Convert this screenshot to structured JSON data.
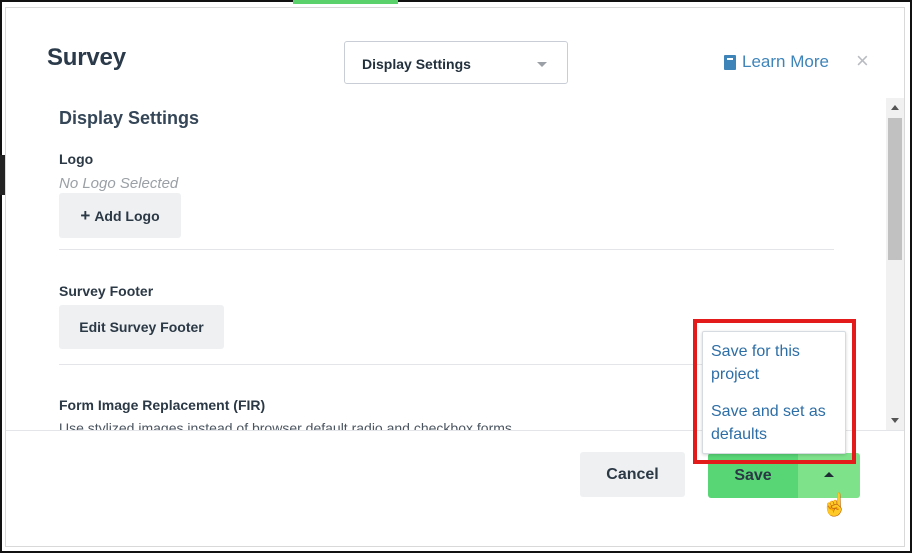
{
  "modal": {
    "title": "Survey",
    "close_icon": "close-icon"
  },
  "header": {
    "select_value": "Display Settings",
    "learn_more_label": "Learn More",
    "learn_more_icon": "book-icon"
  },
  "content": {
    "section_title": "Display Settings",
    "logo": {
      "label": "Logo",
      "status": "No Logo Selected",
      "add_button": "Add Logo",
      "add_icon": "plus-icon"
    },
    "footer": {
      "label": "Survey Footer",
      "edit_button": "Edit Survey Footer"
    },
    "fir": {
      "label": "Form Image Replacement (FIR)",
      "description": "Use stylized images instead of browser default radio and checkbox forms"
    }
  },
  "footer_buttons": {
    "cancel": "Cancel",
    "save": "Save",
    "save_menu_toggle_icon": "caret-up-icon"
  },
  "save_menu": {
    "items": [
      {
        "line1": "Save for this",
        "line2": "project"
      },
      {
        "line1": "Save and set as",
        "line2": "defaults"
      }
    ]
  },
  "colors": {
    "save_green": "#58d676",
    "save_toggle_green": "#7ee28b",
    "link_blue": "#3f84b9",
    "highlight_red": "#e31b1b"
  },
  "cursor": {
    "icon": "hand-pointer-icon"
  }
}
